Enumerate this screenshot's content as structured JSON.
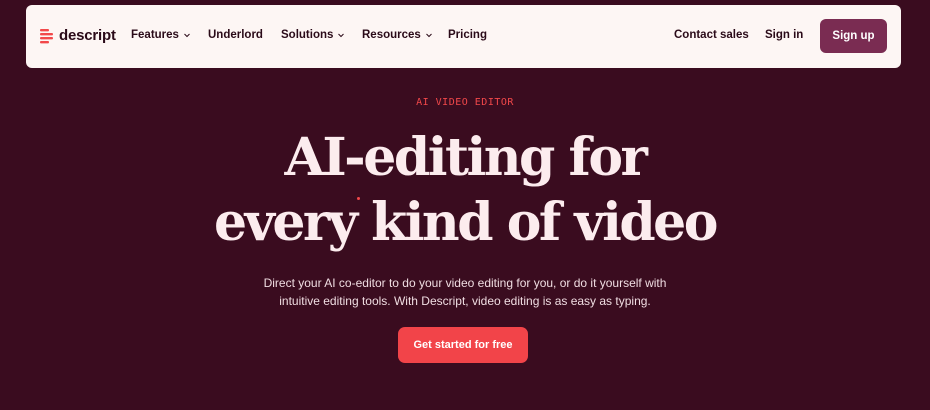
{
  "nav": {
    "logo_text": "descript",
    "items": [
      {
        "label": "Features",
        "dropdown": true
      },
      {
        "label": "Underlord",
        "dropdown": false
      },
      {
        "label": "Solutions",
        "dropdown": true
      },
      {
        "label": "Resources",
        "dropdown": true
      },
      {
        "label": "Pricing",
        "dropdown": false
      }
    ],
    "contact_sales": "Contact sales",
    "sign_in": "Sign in",
    "sign_up": "Sign up"
  },
  "hero": {
    "eyebrow": "AI VIDEO EDITOR",
    "headline_line1": "AI-editing for",
    "headline_line2": "every kind of video",
    "subtitle_line1": "Direct your AI co-editor to do your video editing for you, or do it yourself with",
    "subtitle_line2": "intuitive editing tools. With Descript, video editing is as easy as typing.",
    "cta_label": "Get started for free"
  },
  "colors": {
    "background": "#3a0c1f",
    "nav_background": "#fdf6f4",
    "accent": "#f24449",
    "signup_button": "#7a2c52",
    "headline": "#fcecee"
  }
}
